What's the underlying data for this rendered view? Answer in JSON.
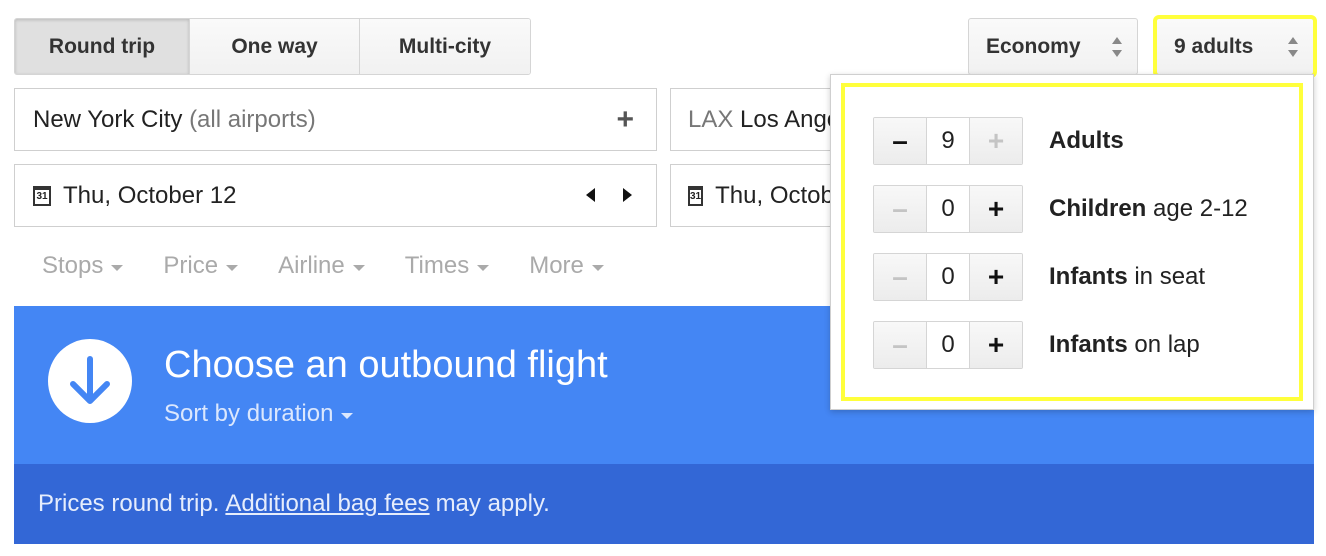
{
  "trip_types": [
    {
      "label": "Round trip",
      "selected": true
    },
    {
      "label": "One way",
      "selected": false
    },
    {
      "label": "Multi-city",
      "selected": false
    }
  ],
  "cabin_select": {
    "value": "Economy"
  },
  "passenger_select": {
    "value": "9 adults"
  },
  "origin": {
    "main": "New York City",
    "suffix": "(all airports)",
    "add_icon": "+"
  },
  "destination": {
    "code": "LAX",
    "city": "Los Angeles"
  },
  "departure_date": {
    "value": "Thu, October 12",
    "icon": "31"
  },
  "return_date": {
    "value": "Thu, October",
    "icon": "31"
  },
  "filters": [
    "Stops",
    "Price",
    "Airline",
    "Times",
    "More"
  ],
  "results_header": {
    "title": "Choose an outbound flight",
    "sort_label": "Sort by duration"
  },
  "prices_note": {
    "before": "Prices round trip.",
    "link": "Additional bag fees",
    "after": "may apply."
  },
  "passengers": [
    {
      "count": "9",
      "label_bold": "Adults",
      "label_rest": "",
      "minus_disabled": false,
      "plus_disabled": true
    },
    {
      "count": "0",
      "label_bold": "Children",
      "label_rest": "age 2-12",
      "minus_disabled": true,
      "plus_disabled": false
    },
    {
      "count": "0",
      "label_bold": "Infants",
      "label_rest": "in seat",
      "minus_disabled": true,
      "plus_disabled": false
    },
    {
      "count": "0",
      "label_bold": "Infants",
      "label_rest": "on lap",
      "minus_disabled": true,
      "plus_disabled": false
    }
  ],
  "stepper_symbols": {
    "minus": "–",
    "plus": "+"
  },
  "colors": {
    "primary_blue": "#4486f4",
    "dark_blue": "#3367d6",
    "highlight": "#ffff3b"
  }
}
